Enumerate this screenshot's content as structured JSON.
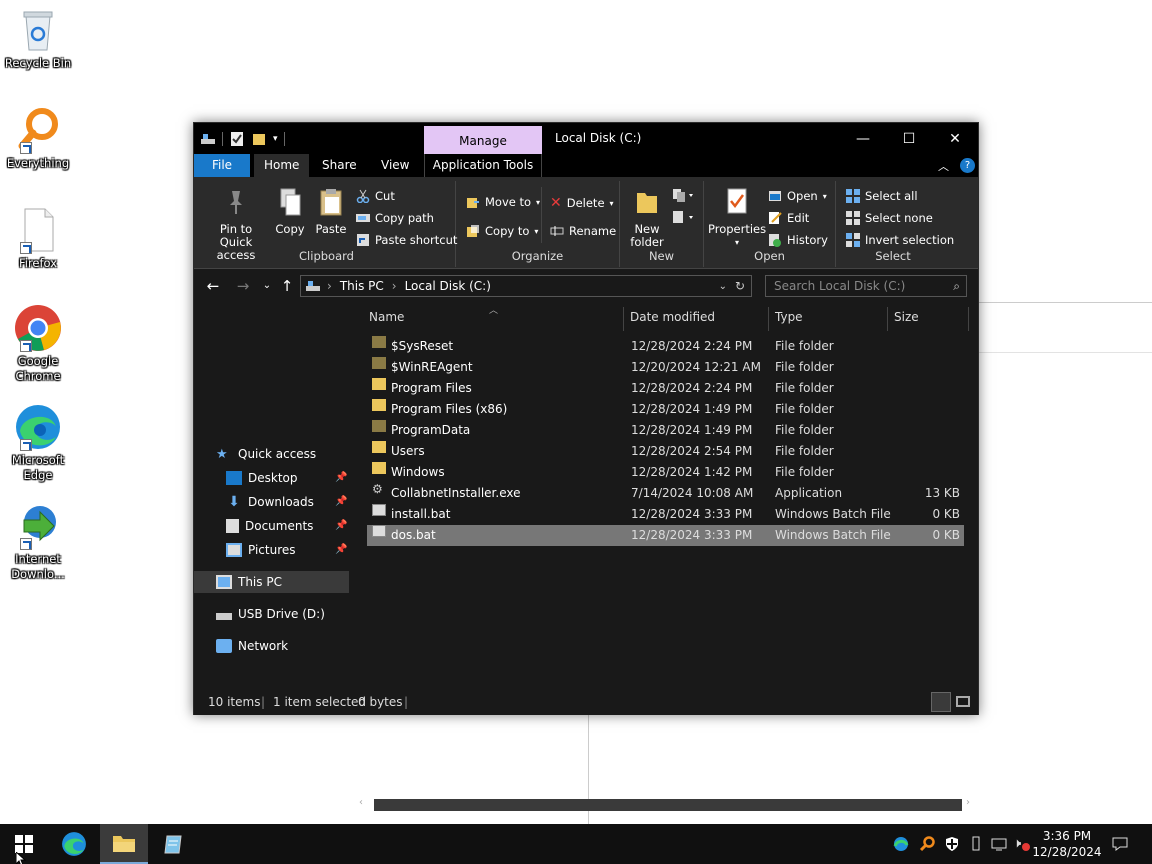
{
  "desktop": {
    "icons": [
      {
        "label": "Recycle Bin"
      },
      {
        "label": "Everything"
      },
      {
        "label": "Firefox"
      },
      {
        "label": "Google Chrome"
      },
      {
        "label": "Microsoft Edge"
      },
      {
        "label": "Internet Downlo..."
      }
    ]
  },
  "window": {
    "title": "Local Disk (C:)",
    "contextual_tab": "Manage",
    "contextual_group": "Application Tools",
    "controls": {
      "minimize": "—",
      "maximize": "☐",
      "close": "✕"
    }
  },
  "ribbon_tabs": [
    "File",
    "Home",
    "Share",
    "View"
  ],
  "ribbon": {
    "clipboard": {
      "label": "Clipboard",
      "pin": "Pin to Quick access",
      "copy": "Copy",
      "paste": "Paste",
      "cut": "Cut",
      "copy_path": "Copy path",
      "paste_shortcut": "Paste shortcut"
    },
    "organize": {
      "label": "Organize",
      "move_to": "Move to",
      "copy_to": "Copy to",
      "delete": "Delete",
      "rename": "Rename"
    },
    "new": {
      "label": "New",
      "new_folder": "New folder"
    },
    "open": {
      "label": "Open",
      "properties": "Properties",
      "open": "Open",
      "edit": "Edit",
      "history": "History"
    },
    "select": {
      "label": "Select",
      "select_all": "Select all",
      "select_none": "Select none",
      "invert": "Invert selection"
    }
  },
  "address": {
    "crumbs": [
      "This PC",
      "Local Disk (C:)"
    ],
    "search_placeholder": "Search Local Disk (C:)"
  },
  "nav": {
    "quick_access": "Quick access",
    "pinned": [
      "Desktop",
      "Downloads",
      "Documents",
      "Pictures"
    ],
    "this_pc": "This PC",
    "usb": "USB Drive (D:)",
    "network": "Network"
  },
  "columns": {
    "name": "Name",
    "date": "Date modified",
    "type": "Type",
    "size": "Size"
  },
  "files": [
    {
      "name": "$SysReset",
      "date": "12/28/2024 2:24 PM",
      "type": "File folder",
      "size": "",
      "kind": "sysfolder"
    },
    {
      "name": "$WinREAgent",
      "date": "12/20/2024 12:21 AM",
      "type": "File folder",
      "size": "",
      "kind": "sysfolder"
    },
    {
      "name": "Program Files",
      "date": "12/28/2024 2:24 PM",
      "type": "File folder",
      "size": "",
      "kind": "folder"
    },
    {
      "name": "Program Files (x86)",
      "date": "12/28/2024 1:49 PM",
      "type": "File folder",
      "size": "",
      "kind": "folder"
    },
    {
      "name": "ProgramData",
      "date": "12/28/2024 1:49 PM",
      "type": "File folder",
      "size": "",
      "kind": "sysfolder"
    },
    {
      "name": "Users",
      "date": "12/28/2024 2:54 PM",
      "type": "File folder",
      "size": "",
      "kind": "folder"
    },
    {
      "name": "Windows",
      "date": "12/28/2024 1:42 PM",
      "type": "File folder",
      "size": "",
      "kind": "folder"
    },
    {
      "name": "CollabnetInstaller.exe",
      "date": "7/14/2024 10:08 AM",
      "type": "Application",
      "size": "13 KB",
      "kind": "exe"
    },
    {
      "name": "install.bat",
      "date": "12/28/2024 3:33 PM",
      "type": "Windows Batch File",
      "size": "0 KB",
      "kind": "bat"
    },
    {
      "name": "dos.bat",
      "date": "12/28/2024 3:33 PM",
      "type": "Windows Batch File",
      "size": "0 KB",
      "kind": "bat",
      "selected": true
    }
  ],
  "status": {
    "count": "10 items",
    "selected": "1 item selected",
    "bytes": "0 bytes"
  },
  "taskbar": {
    "time": "3:36 PM",
    "date": "12/28/2024"
  },
  "colors": {
    "accent": "#1979ca",
    "manage_tab": "#e3c6f5",
    "folder": "#ecc75c",
    "dark_bg": "#191919"
  }
}
